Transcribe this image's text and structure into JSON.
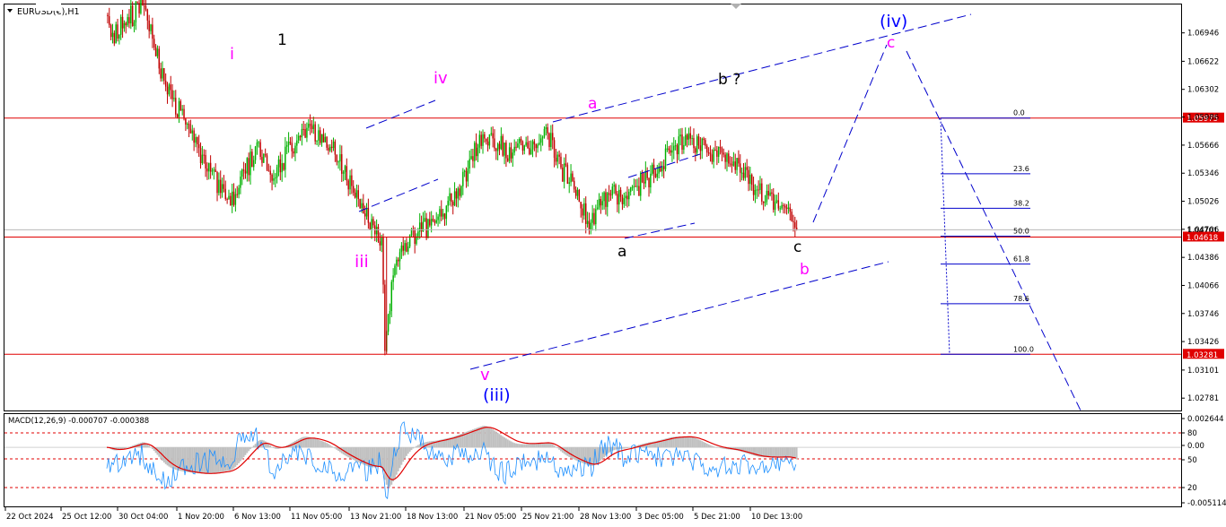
{
  "chart_title": "EURUSD(€),H1",
  "chart_data": {
    "type": "candlestick",
    "symbol": "EURUSD",
    "timeframe": "H1",
    "price_axis_ticks": [
      "1.06946",
      "1.06622",
      "1.06302",
      "1.05986",
      "1.05666",
      "1.05346",
      "1.05026",
      "1.04706",
      "1.04386",
      "1.04066",
      "1.03746",
      "1.03426",
      "1.03101",
      "1.02781"
    ],
    "price_range": [
      1.0264,
      1.0728
    ],
    "time_axis_labels": [
      "22 Oct 2024",
      "25 Oct 12:00",
      "30 Oct 04:00",
      "1 Nov 20:00",
      "6 Nov 13:00",
      "11 Nov 05:00",
      "13 Nov 21:00",
      "18 Nov 13:00",
      "21 Nov 05:00",
      "25 Nov 21:00",
      "28 Nov 13:00",
      "3 Dec 05:00",
      "5 Dec 21:00",
      "10 Dec 13:00"
    ],
    "swing_points": [
      {
        "bar": 60,
        "price": 1.0715
      },
      {
        "bar": 63,
        "price": 1.069
      },
      {
        "bar": 82,
        "price": 1.0726
      },
      {
        "bar": 95,
        "price": 1.064
      },
      {
        "bar": 108,
        "price": 1.059
      },
      {
        "bar": 120,
        "price": 1.054
      },
      {
        "bar": 135,
        "price": 1.0498
      },
      {
        "bar": 152,
        "price": 1.057
      },
      {
        "bar": 160,
        "price": 1.0526
      },
      {
        "bar": 178,
        "price": 1.0585
      },
      {
        "bar": 192,
        "price": 1.0576
      },
      {
        "bar": 203,
        "price": 1.0536
      },
      {
        "bar": 208,
        "price": 1.052
      },
      {
        "bar": 218,
        "price": 1.0478
      },
      {
        "bar": 226,
        "price": 1.0462
      },
      {
        "bar": 228,
        "price": 1.0332
      },
      {
        "bar": 233,
        "price": 1.0418
      },
      {
        "bar": 240,
        "price": 1.0455
      },
      {
        "bar": 248,
        "price": 1.0468
      },
      {
        "bar": 258,
        "price": 1.0478
      },
      {
        "bar": 268,
        "price": 1.0502
      },
      {
        "bar": 278,
        "price": 1.054
      },
      {
        "bar": 287,
        "price": 1.0579
      },
      {
        "bar": 296,
        "price": 1.0568
      },
      {
        "bar": 305,
        "price": 1.0558
      },
      {
        "bar": 317,
        "price": 1.0571
      },
      {
        "bar": 326,
        "price": 1.058
      },
      {
        "bar": 334,
        "price": 1.0541
      },
      {
        "bar": 342,
        "price": 1.0516
      },
      {
        "bar": 352,
        "price": 1.0478
      },
      {
        "bar": 362,
        "price": 1.0512
      },
      {
        "bar": 372,
        "price": 1.0506
      },
      {
        "bar": 380,
        "price": 1.052
      },
      {
        "bar": 390,
        "price": 1.0534
      },
      {
        "bar": 400,
        "price": 1.0558
      },
      {
        "bar": 412,
        "price": 1.0574
      },
      {
        "bar": 424,
        "price": 1.0556
      },
      {
        "bar": 438,
        "price": 1.0548
      },
      {
        "bar": 452,
        "price": 1.0516
      },
      {
        "bar": 463,
        "price": 1.0502
      },
      {
        "bar": 470,
        "price": 1.0494
      },
      {
        "bar": 476,
        "price": 1.047
      }
    ],
    "horizontal_levels": [
      {
        "label": "1.05975",
        "price": 1.05975
      },
      {
        "label": "1.04701",
        "price": 1.04701
      },
      {
        "label": "1.04618",
        "price": 1.04618
      },
      {
        "label": "1.03281",
        "price": 1.03281
      }
    ],
    "fibonacci": {
      "high_price": 1.05975,
      "low_price": 1.03281,
      "levels": [
        {
          "label": "0.0",
          "ratio": 0.0
        },
        {
          "label": "23.6",
          "ratio": 0.236
        },
        {
          "label": "38.2",
          "ratio": 0.382
        },
        {
          "label": "50.0",
          "ratio": 0.5
        },
        {
          "label": "61.8",
          "ratio": 0.618
        },
        {
          "label": "78.6",
          "ratio": 0.786
        },
        {
          "label": "100.0",
          "ratio": 1.0
        }
      ]
    },
    "wave_labels": [
      {
        "text": "i",
        "color": "#ff00ff"
      },
      {
        "text": "1",
        "color": "#000000"
      },
      {
        "text": "iv",
        "color": "#ff00ff"
      },
      {
        "text": "iii",
        "color": "#ff00ff"
      },
      {
        "text": "a",
        "color": "#ff00ff"
      },
      {
        "text": "b ?",
        "color": "#000000"
      },
      {
        "text": "(iv)",
        "color": "#0000ff"
      },
      {
        "text": "c",
        "color": "#ff00ff"
      },
      {
        "text": "a",
        "color": "#000000"
      },
      {
        "text": "c",
        "color": "#000000"
      },
      {
        "text": "b",
        "color": "#ff00ff"
      },
      {
        "text": "v",
        "color": "#ff00ff"
      },
      {
        "text": "(iii)",
        "color": "#0000ff"
      }
    ],
    "macd": {
      "title": "MACD(12,26,9) -0.000707 -0.000388",
      "fast": 12,
      "slow": 26,
      "signal": 9,
      "main_value": -0.000707,
      "signal_value": -0.000388,
      "axis_ticks": [
        "0.002644",
        "80",
        "0.00",
        "50",
        "20",
        "-0.005114"
      ],
      "range": [
        -0.0055,
        0.0031
      ]
    },
    "colors": {
      "bull_candle": "#00b000",
      "bear_candle": "#c00000",
      "level_line": "#e00000",
      "trend_line": "#0000cc",
      "fib_line": "#0000cc",
      "macd_histogram": "#c0c0c0",
      "macd_signal": "#e00000",
      "stochastic": "#1e90ff"
    }
  }
}
